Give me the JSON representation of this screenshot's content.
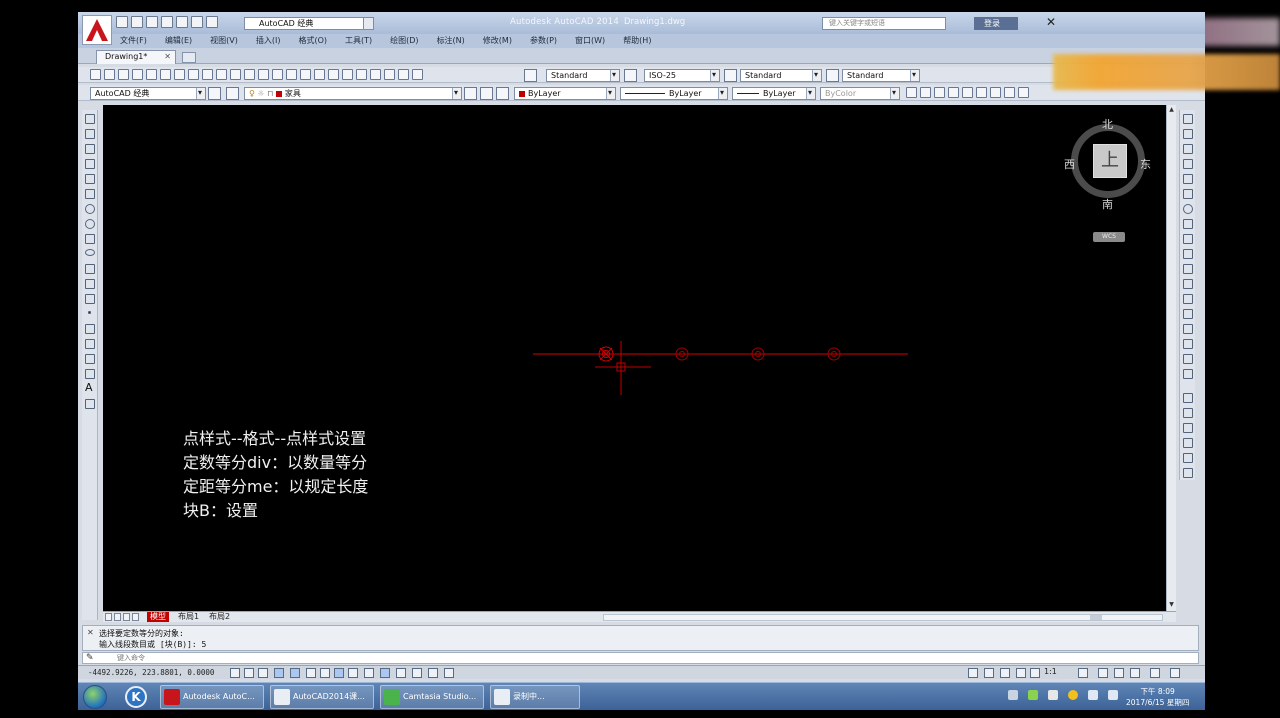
{
  "title_bar": {
    "workspace": "AutoCAD 经典",
    "app_title": "Autodesk AutoCAD 2014",
    "file_name": "Drawing1.dwg",
    "search_placeholder": "键入关键字或短语",
    "login": "登录"
  },
  "menu": [
    "文件(F)",
    "编辑(E)",
    "视图(V)",
    "插入(I)",
    "格式(O)",
    "工具(T)",
    "绘图(D)",
    "标注(N)",
    "修改(M)",
    "参数(P)",
    "窗口(W)",
    "帮助(H)"
  ],
  "doc_tab": {
    "label": "Drawing1*"
  },
  "styles_toolbar": {
    "text_style": "Standard",
    "dim_style": "ISO-25",
    "table_style": "Standard",
    "multileader_style": "Standard"
  },
  "layers_toolbar": {
    "workspace": "AutoCAD 经典",
    "layer": "家具",
    "color": "ByLayer",
    "linetype": "ByLayer",
    "lineweight": "ByLayer",
    "plotstyle": "ByColor"
  },
  "viewcube": {
    "north": "北",
    "south": "南",
    "east": "东",
    "west": "西",
    "face": "上",
    "wcs": "WCS"
  },
  "overlay_notes": [
    "点样式--格式--点样式设置",
    "定数等分div：以数量等分",
    "定距等分me：以规定长度",
    "块B：设置"
  ],
  "layout_tabs": [
    "模型",
    "布局1",
    "布局2"
  ],
  "command": {
    "history_1": "选择要定数等分的对象:",
    "history_2": "输入线段数目或 [块(B)]: 5",
    "input_placeholder": "键入命令"
  },
  "status": {
    "coords": "-4492.9226, 223.8801, 0.0000",
    "scale": "1:1"
  },
  "taskbar": {
    "items": [
      "Autodesk AutoC...",
      "AutoCAD2014课...",
      "Camtasia Studio...",
      "录制中..."
    ],
    "time": "下午 8:09",
    "date": "2017/6/15 星期四"
  },
  "colors": {
    "canvas": "#000000",
    "drawing_red": "#d40000",
    "model_tab": "#c20000"
  }
}
